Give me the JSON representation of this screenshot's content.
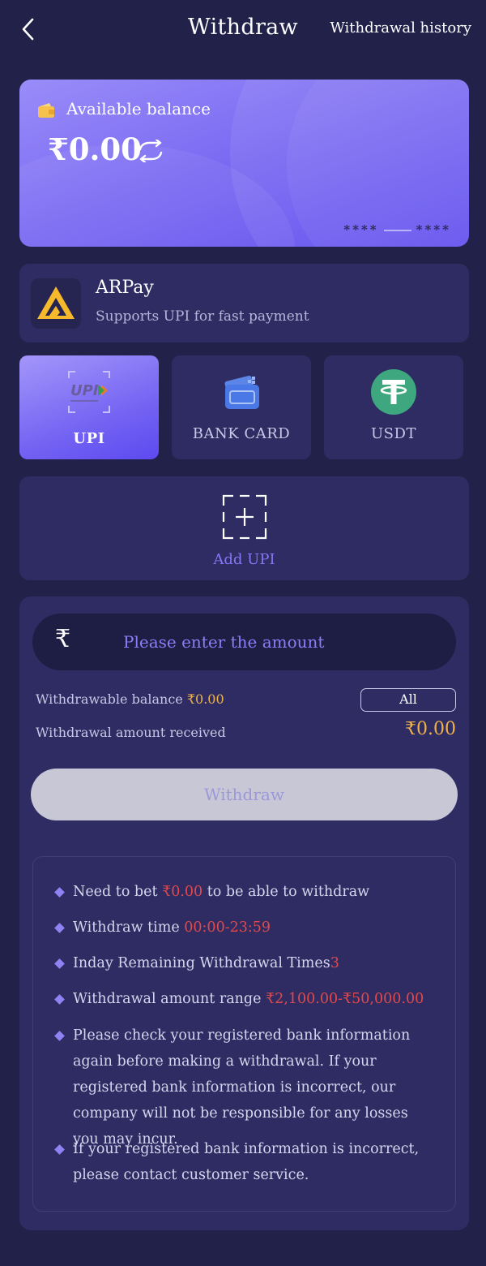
{
  "header": {
    "title": "Withdraw",
    "history_label": "Withdrawal history"
  },
  "balance_card": {
    "label": "Available balance",
    "amount": "₹0.00",
    "mask_left": "****",
    "mask_right": "****"
  },
  "provider": {
    "name": "ARPay",
    "description": "Supports UPI for fast payment"
  },
  "methods": [
    {
      "label": "UPI",
      "icon": "upi-icon",
      "active": true
    },
    {
      "label": "BANK CARD",
      "icon": "bank-card-icon",
      "active": false
    },
    {
      "label": "USDT",
      "icon": "usdt-icon",
      "active": false
    }
  ],
  "add_upi": {
    "label": "Add UPI"
  },
  "form": {
    "currency_symbol": "₹",
    "amount_placeholder": "Please enter the amount",
    "withdrawable_label": "Withdrawable balance",
    "withdrawable_value": "₹0.00",
    "all_label": "All",
    "received_label": "Withdrawal amount received",
    "received_value": "₹0.00",
    "withdraw_button": "Withdraw"
  },
  "rules": [
    {
      "before": "Need to bet ",
      "highlight": "₹0.00",
      "after": " to be able to withdraw"
    },
    {
      "before": "Withdraw time ",
      "highlight": "00:00-23:59",
      "after": ""
    },
    {
      "before": "Inday Remaining Withdrawal Times",
      "highlight": "3",
      "after": ""
    },
    {
      "before": "Withdrawal amount range ",
      "highlight": "₹2,100.00-₹50,000.00",
      "after": ""
    },
    {
      "before": "Please check your registered bank information again before making a withdrawal. If your registered bank information is incorrect, our company will not be responsible for any losses you may incur.",
      "highlight": "",
      "after": ""
    },
    {
      "before": "If your registered bank information is incorrect, please contact customer service.",
      "highlight": "",
      "after": ""
    }
  ],
  "colors": {
    "background": "#22214a",
    "panel": "#2e2c62",
    "accent": "#7c6cf3",
    "gold": "#f0b34a",
    "highlight_red": "#e2494d"
  }
}
